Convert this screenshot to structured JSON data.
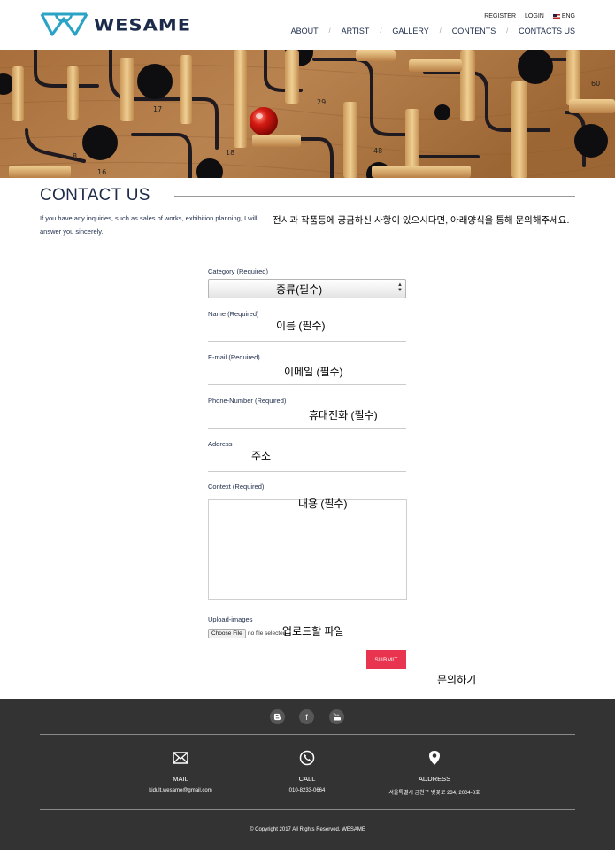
{
  "brand": {
    "name": "WESAME"
  },
  "top_nav": {
    "register": "REGISTER",
    "login": "LOGIN",
    "lang": "ENG"
  },
  "main_nav": [
    {
      "label": "ABOUT"
    },
    {
      "label": "ARTIST"
    },
    {
      "label": "GALLERY"
    },
    {
      "label": "CONTENTS"
    },
    {
      "label": "CONTACTS US"
    }
  ],
  "page": {
    "title": "CONTACT US",
    "intro_en": "If you have any inquiries, such as sales of works, exhibition planning, I will answer you sincerely.",
    "intro_ko": "전시과 작품등에 궁금하신 사항이 있으시다면, 아래양식을 통해 문의해주세요."
  },
  "form": {
    "category": {
      "label": "Category (Required)",
      "note": "종류(필수)"
    },
    "name": {
      "label": "Name (Required)",
      "note": "이름 (필수)"
    },
    "email": {
      "label": "E-mail (Required)",
      "note": "이메일 (필수)"
    },
    "phone": {
      "label": "Phone-Number (Required)",
      "note": "휴대전화 (필수)"
    },
    "address": {
      "label": "Address",
      "note": "주소"
    },
    "context": {
      "label": "Context (Required)",
      "note": "내용 (필수)"
    },
    "upload": {
      "label": "Upload-images",
      "button": "Choose File",
      "status": "no file selected",
      "note": "업로드할 파일"
    },
    "submit": {
      "label": "SUBMIT",
      "note": "문의하기"
    }
  },
  "footer": {
    "social": [
      {
        "icon": "blogger-icon"
      },
      {
        "icon": "facebook-icon",
        "glyph": "f"
      },
      {
        "icon": "youtube-icon"
      }
    ],
    "mail": {
      "label": "MAIL",
      "value": "kidult.wesame@gmail.com"
    },
    "call": {
      "label": "CALL",
      "value": "010-8233-0664"
    },
    "address": {
      "label": "ADDRESS",
      "value": "서울특별시 금천구 벚꽃로 234, 2004-8호"
    },
    "copyright": "© Copyright 2017 All Rights Reserved. WESAME"
  },
  "colors": {
    "accent": "#e8344e",
    "navy": "#1d2b4a",
    "logo_blue": "#2aa3c7",
    "footer_bg": "#333333"
  }
}
